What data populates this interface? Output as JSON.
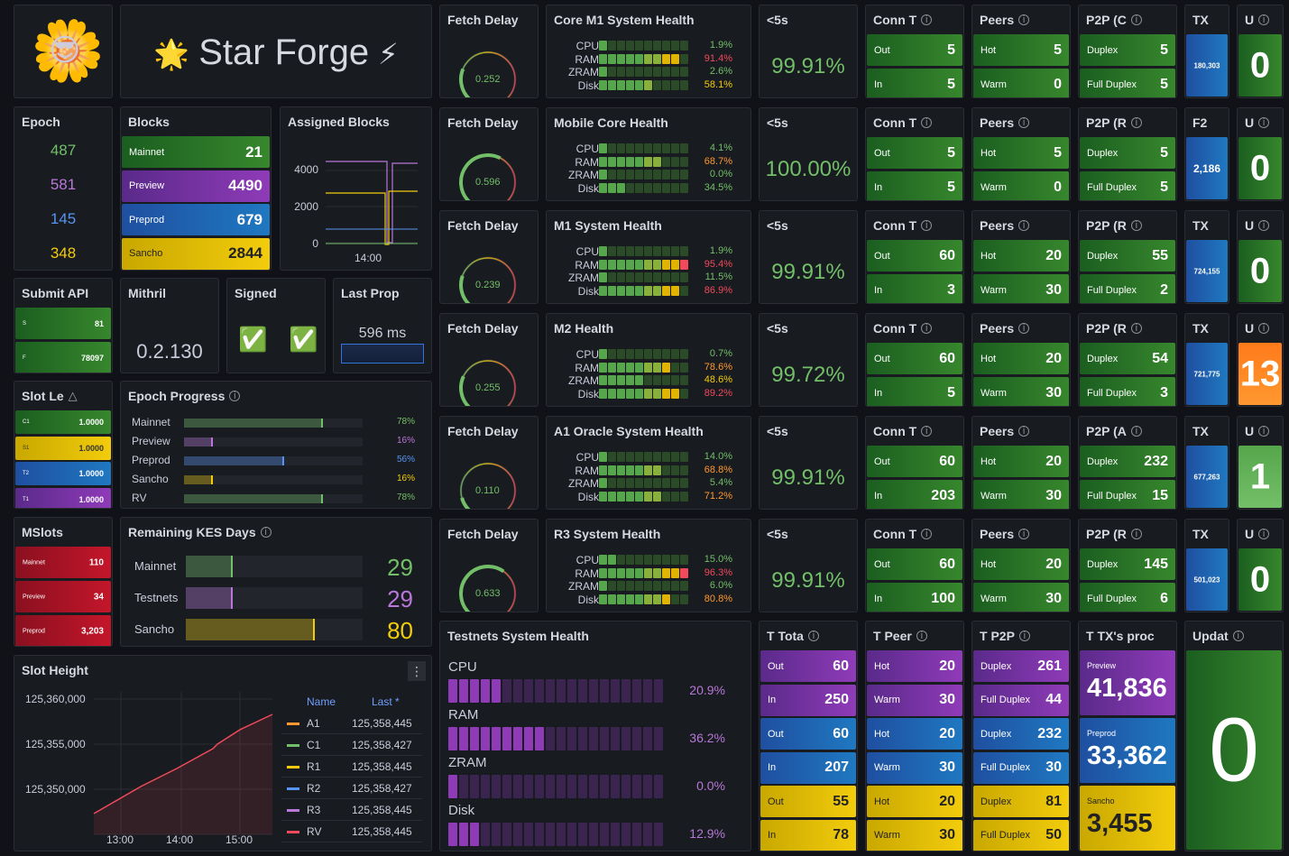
{
  "logo": {
    "title": "Star Forge",
    "star_emoji": "🌟",
    "bolt_emoji": "⚡",
    "mascot_emoji": "🌼",
    "shades_emoji": "😎"
  },
  "epoch": {
    "title": "Epoch",
    "values": [
      "487",
      "581",
      "145",
      "348"
    ],
    "colors": [
      "#73bf69",
      "#b877d9",
      "#5794f2",
      "#f2cc0c"
    ]
  },
  "blocks": {
    "title": "Blocks",
    "rows": [
      {
        "label": "Mainnet",
        "value": "21"
      },
      {
        "label": "Preview",
        "value": "4490"
      },
      {
        "label": "Preprod",
        "value": "679"
      },
      {
        "label": "Sancho",
        "value": "2844"
      }
    ]
  },
  "assigned": {
    "title": "Assigned Blocks",
    "yticks": [
      "4000",
      "2000",
      "0"
    ],
    "xtick": "14:00"
  },
  "submit_api": {
    "title": "Submit API",
    "rows": [
      {
        "label": "S",
        "value": "81"
      },
      {
        "label": "F",
        "value": "78097"
      }
    ]
  },
  "mithril": {
    "title": "Mithril",
    "value": "0.2.130"
  },
  "signed": {
    "title": "Signed",
    "marks": [
      "✅",
      "✅"
    ]
  },
  "last_prop": {
    "title": "Last Prop",
    "value": "596 ms"
  },
  "slot_leader": {
    "title": "Slot Le",
    "rows": [
      {
        "label": "C1",
        "value": "1.0000"
      },
      {
        "label": "S1",
        "value": "1.0000"
      },
      {
        "label": "T2",
        "value": "1.0000"
      },
      {
        "label": "T1",
        "value": "1.0000"
      }
    ]
  },
  "epoch_progress": {
    "title": "Epoch Progress",
    "rows": [
      {
        "label": "Mainnet",
        "pct": "78%",
        "frac": 0.78,
        "color": "#73bf69"
      },
      {
        "label": "Preview",
        "pct": "16%",
        "frac": 0.16,
        "color": "#b877d9"
      },
      {
        "label": "Preprod",
        "pct": "56%",
        "frac": 0.56,
        "color": "#5794f2"
      },
      {
        "label": "Sancho",
        "pct": "16%",
        "frac": 0.16,
        "color": "#f2cc0c"
      },
      {
        "label": "RV",
        "pct": "78%",
        "frac": 0.78,
        "color": "#73bf69"
      }
    ]
  },
  "mslots": {
    "title": "MSlots",
    "rows": [
      {
        "label": "Mainnet",
        "value": "110"
      },
      {
        "label": "Preview",
        "value": "34"
      },
      {
        "label": "Preprod",
        "value": "3,203"
      }
    ]
  },
  "kes": {
    "title": "Remaining KES Days",
    "rows": [
      {
        "label": "Mainnet",
        "value": "29",
        "frac": 0.29,
        "color": "#73bf69"
      },
      {
        "label": "Testnets",
        "value": "29",
        "frac": 0.29,
        "color": "#b877d9"
      },
      {
        "label": "Sancho",
        "value": "80",
        "frac": 0.8,
        "color": "#f2cc0c"
      }
    ]
  },
  "slot_height": {
    "title": "Slot Height",
    "yticks": [
      "125,360,000",
      "125,355,000",
      "125,350,000"
    ],
    "xticks": [
      "13:00",
      "14:00",
      "15:00"
    ],
    "legend_header": {
      "name": "Name",
      "last": "Last *"
    },
    "legend": [
      {
        "name": "A1",
        "value": "125,358,445",
        "color": "#ff9830"
      },
      {
        "name": "C1",
        "value": "125,358,427",
        "color": "#73bf69"
      },
      {
        "name": "R1",
        "value": "125,358,445",
        "color": "#f2cc0c"
      },
      {
        "name": "R2",
        "value": "125,358,427",
        "color": "#5794f2"
      },
      {
        "name": "R3",
        "value": "125,358,445",
        "color": "#b877d9"
      },
      {
        "name": "RV",
        "value": "125,358,445",
        "color": "#f2495c"
      }
    ]
  },
  "rows": [
    {
      "fetch": "0.252",
      "fetch_frac": 0.25,
      "health_title": "Core M1 System Health",
      "pcts": [
        "1.9%",
        "91.4%",
        "2.6%",
        "58.1%"
      ],
      "cells": [
        1,
        9,
        1,
        6
      ],
      "five": "99.91%",
      "conn": [
        "5",
        "5"
      ],
      "peers": [
        "5",
        "0"
      ],
      "p2p_title": "P2P (C",
      "p2p": [
        "5",
        "5"
      ],
      "tx": "180,303",
      "tx_title": "TX",
      "u": "0",
      "u_color": "green"
    },
    {
      "fetch": "0.596",
      "fetch_frac": 0.6,
      "health_title": "Mobile Core Health",
      "pcts": [
        "4.1%",
        "68.7%",
        "0.0%",
        "34.5%"
      ],
      "cells": [
        1,
        7,
        0,
        3
      ],
      "five": "100.00%",
      "conn": [
        "5",
        "5"
      ],
      "peers": [
        "5",
        "0"
      ],
      "p2p_title": "P2P (R",
      "p2p": [
        "5",
        "5"
      ],
      "tx": "2,186",
      "tx_title": "F2",
      "u": "0",
      "u_color": "green"
    },
    {
      "fetch": "0.239",
      "fetch_frac": 0.24,
      "health_title": "M1 System Health",
      "pcts": [
        "1.9%",
        "95.4%",
        "11.5%",
        "86.9%"
      ],
      "cells": [
        1,
        10,
        1,
        9
      ],
      "five": "99.91%",
      "conn": [
        "60",
        "3"
      ],
      "peers": [
        "20",
        "30"
      ],
      "p2p_title": "P2P (R",
      "p2p": [
        "55",
        "2"
      ],
      "tx": "724,155",
      "tx_title": "TX",
      "u": "0",
      "u_color": "green"
    },
    {
      "fetch": "0.255",
      "fetch_frac": 0.26,
      "health_title": "M2 Health",
      "pcts": [
        "0.7%",
        "78.6%",
        "48.6%",
        "89.2%"
      ],
      "cells": [
        1,
        8,
        5,
        9
      ],
      "five": "99.72%",
      "conn": [
        "60",
        "5"
      ],
      "peers": [
        "20",
        "30"
      ],
      "p2p_title": "P2P (R",
      "p2p": [
        "54",
        "3"
      ],
      "tx": "721,775",
      "tx_title": "TX",
      "u": "13",
      "u_color": "orange"
    },
    {
      "fetch": "0.110",
      "fetch_frac": 0.11,
      "health_title": "A1 Oracle System Health",
      "pcts": [
        "14.0%",
        "68.8%",
        "5.4%",
        "71.2%"
      ],
      "cells": [
        1,
        7,
        1,
        7
      ],
      "five": "99.91%",
      "conn": [
        "60",
        "203"
      ],
      "peers": [
        "20",
        "30"
      ],
      "p2p_title": "P2P (A",
      "p2p": [
        "232",
        "15"
      ],
      "tx": "677,263",
      "tx_title": "TX",
      "u": "1",
      "u_color": "lgreen"
    },
    {
      "fetch": "0.633",
      "fetch_frac": 0.63,
      "health_title": "R3 System Health",
      "pcts": [
        "15.0%",
        "96.3%",
        "6.0%",
        "80.8%"
      ],
      "cells": [
        2,
        10,
        1,
        8
      ],
      "five": "99.91%",
      "conn": [
        "60",
        "100"
      ],
      "peers": [
        "20",
        "30"
      ],
      "p2p_title": "P2P (R",
      "p2p": [
        "145",
        "6"
      ],
      "tx": "501,023",
      "tx_title": "TX",
      "u": "0",
      "u_color": "green"
    }
  ],
  "common": {
    "fetch_title": "Fetch Delay",
    "five_title": "<5s",
    "conn_title": "Conn T",
    "peers_title": "Peers",
    "u_title": "U",
    "res": [
      "CPU",
      "RAM",
      "ZRAM",
      "Disk"
    ],
    "out": "Out",
    "in": "In",
    "hot": "Hot",
    "warm": "Warm",
    "duplex": "Duplex",
    "full_duplex": "Full Duplex"
  },
  "testnets": {
    "title": "Testnets System Health",
    "rows": [
      {
        "label": "CPU",
        "pct": "20.9%",
        "cells": 5
      },
      {
        "label": "RAM",
        "pct": "36.2%",
        "cells": 9
      },
      {
        "label": "ZRAM",
        "pct": "0.0%",
        "cells": 1
      },
      {
        "label": "Disk",
        "pct": "12.9%",
        "cells": 3
      }
    ]
  },
  "t_total": {
    "title": "T Tota",
    "rows": [
      {
        "l": "Out",
        "v": "60"
      },
      {
        "l": "In",
        "v": "250"
      },
      {
        "l": "Out",
        "v": "60"
      },
      {
        "l": "In",
        "v": "207"
      },
      {
        "l": "Out",
        "v": "55"
      },
      {
        "l": "In",
        "v": "78"
      }
    ]
  },
  "t_peer": {
    "title": "T Peer",
    "rows": [
      {
        "l": "Hot",
        "v": "20"
      },
      {
        "l": "Warm",
        "v": "30"
      },
      {
        "l": "Hot",
        "v": "20"
      },
      {
        "l": "Warm",
        "v": "30"
      },
      {
        "l": "Hot",
        "v": "20"
      },
      {
        "l": "Warm",
        "v": "30"
      }
    ]
  },
  "t_p2p": {
    "title": "T P2P",
    "rows": [
      {
        "l": "Duplex",
        "v": "261"
      },
      {
        "l": "Full Duplex",
        "v": "44"
      },
      {
        "l": "Duplex",
        "v": "232"
      },
      {
        "l": "Full Duplex",
        "v": "30"
      },
      {
        "l": "Duplex",
        "v": "81"
      },
      {
        "l": "Full Duplex",
        "v": "50"
      }
    ]
  },
  "t_tx": {
    "title": "T TX's proc",
    "rows": [
      {
        "l": "Preview",
        "v": "41,836"
      },
      {
        "l": "Preprod",
        "v": "33,362"
      },
      {
        "l": "Sancho",
        "v": "3,455"
      }
    ]
  },
  "update": {
    "title": "Updat",
    "value": "0"
  }
}
